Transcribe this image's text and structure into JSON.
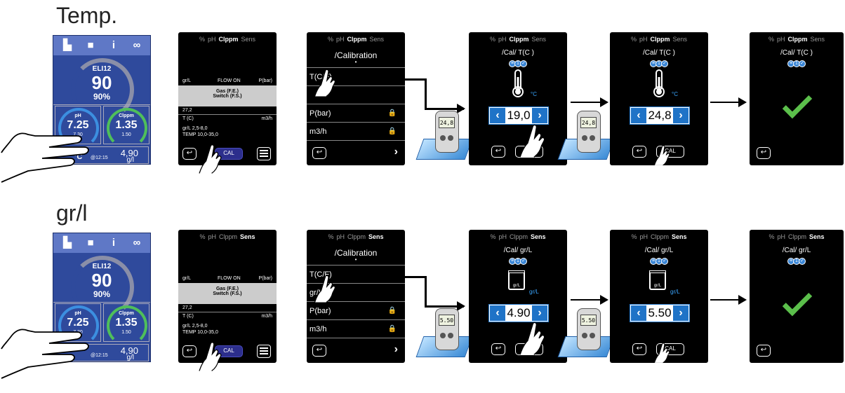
{
  "rows": [
    {
      "title": "Temp.",
      "dashboard": {
        "label": "ELI12",
        "value": "90",
        "pct": "90%",
        "ph": "pH",
        "ph_val": "7.25",
        "ph_set": "7.30",
        "cl": "Clppm",
        "cl_val": "1.35",
        "cl_set": "1.50",
        "bottom_val": "4,90",
        "bottom_unit": "g/l",
        "unit": "°C",
        "time": "@12:15"
      },
      "scr2": {
        "tabs": [
          "%",
          "pH",
          "Clppm",
          "Sens"
        ],
        "active_tab": 2,
        "lines": [
          "gr/L",
          "FLOW ON",
          "P(bar)"
        ],
        "box1": "Gas (F.E.)",
        "box2": "Switch (F.S.)",
        "v1": "27,2",
        "t": "T (C)",
        "m3": "m3/h",
        "range1": "gr/L 2,5-8,0",
        "range2": "TEMP 10,0-35,0",
        "cal": "CAL"
      },
      "scr3": {
        "tabs": [
          "%",
          "pH",
          "Clppm",
          "Sens"
        ],
        "active_tab": 2,
        "title": "/Calibration",
        "items": [
          "T(C/F)",
          "",
          "P(bar)",
          "m3/h"
        ],
        "bullet": "•"
      },
      "device_a": "24,8",
      "scr4": {
        "tabs": [
          "%",
          "pH",
          "Clppm",
          "Sens"
        ],
        "active_tab": 2,
        "title": "/Cal/ T(C )",
        "unit": "°C",
        "value": "19,0",
        "cal": "CAL"
      },
      "device_b": "24,8",
      "scr5": {
        "tabs": [
          "%",
          "pH",
          "Clppm",
          "Sens"
        ],
        "active_tab": 2,
        "title": "/Cal/ T(C )",
        "unit": "°C",
        "value": "24,8",
        "cal": "CAL"
      },
      "scr6": {
        "tabs": [
          "%",
          "pH",
          "Clppm",
          "Sens"
        ],
        "active_tab": 2,
        "title": "/Cal/ T(C )"
      }
    },
    {
      "title": "gr/l",
      "dashboard": {
        "label": "ELI12",
        "value": "90",
        "pct": "90%",
        "ph": "pH",
        "ph_val": "7.25",
        "ph_set": "7.30",
        "cl": "Clppm",
        "cl_val": "1.35",
        "cl_set": "1.50",
        "bottom_val": "4,90",
        "bottom_unit": "g/l",
        "unit": "",
        "time": "@12:15"
      },
      "scr2": {
        "tabs": [
          "%",
          "pH",
          "Clppm",
          "Sens"
        ],
        "active_tab": 3,
        "lines": [
          "gr/L",
          "FLOW ON",
          "P(bar)"
        ],
        "box1": "Gas (F.E.)",
        "box2": "Switch (F.S.)",
        "v1": "27,2",
        "t": "T (C)",
        "m3": "m3/h",
        "range1": "gr/L 2,5-8,0",
        "range2": "TEMP 10,0-35,0",
        "cal": "CAL"
      },
      "scr3": {
        "tabs": [
          "%",
          "pH",
          "Clppm",
          "Sens"
        ],
        "active_tab": 3,
        "title": "/Calibration",
        "items": [
          "T(C/F)",
          "gr/L",
          "P(bar)",
          "m3/h"
        ],
        "bullet": "•"
      },
      "device_a": "5.50",
      "scr4": {
        "tabs": [
          "%",
          "pH",
          "Clppm",
          "Sens"
        ],
        "active_tab": 3,
        "title": "/Cal/ gr/L",
        "unit": "gr/L",
        "value": "4.90",
        "cal": "CAL",
        "icon_label": "gr/L"
      },
      "device_b": "5.50",
      "scr5": {
        "tabs": [
          "%",
          "pH",
          "Clppm",
          "Sens"
        ],
        "active_tab": 3,
        "title": "/Cal/ gr/L",
        "unit": "gr/L",
        "value": "5.50",
        "cal": "CAL",
        "icon_label": "gr/L"
      },
      "scr6": {
        "tabs": [
          "%",
          "pH",
          "Clppm",
          "Sens"
        ],
        "active_tab": 3,
        "title": "/Cal/ gr/L"
      }
    }
  ],
  "colors": {
    "accent": "#1f73c7",
    "check": "#5bbf4b",
    "dashboard": "#2f4a9c"
  }
}
